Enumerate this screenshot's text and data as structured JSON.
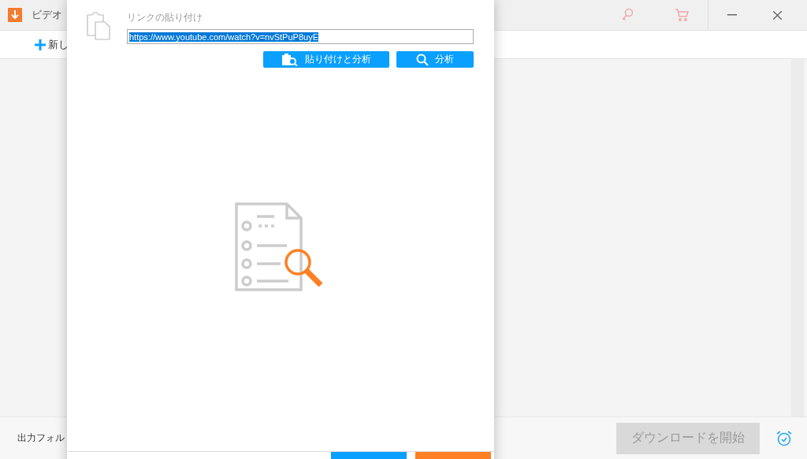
{
  "app": {
    "title": "ビデオ"
  },
  "toolbar": {
    "new_button": "新し"
  },
  "dialog": {
    "label": "リンクの貼り付け",
    "url_field": {
      "value": "https://www.youtube.com/watch?v=nvStPuP8uyE",
      "selected": true
    },
    "buttons": [
      {
        "kind": "paste",
        "label": "貼り付けと分析"
      },
      {
        "kind": "search",
        "label": "分析"
      }
    ],
    "footer_buttons": [
      {
        "kind": "primary"
      },
      {
        "kind": "cancel"
      }
    ]
  },
  "bottom_bar": {
    "output_label": "出力フォル",
    "download_button": {
      "label": "ダウンロードを開始",
      "disabled": true
    }
  }
}
